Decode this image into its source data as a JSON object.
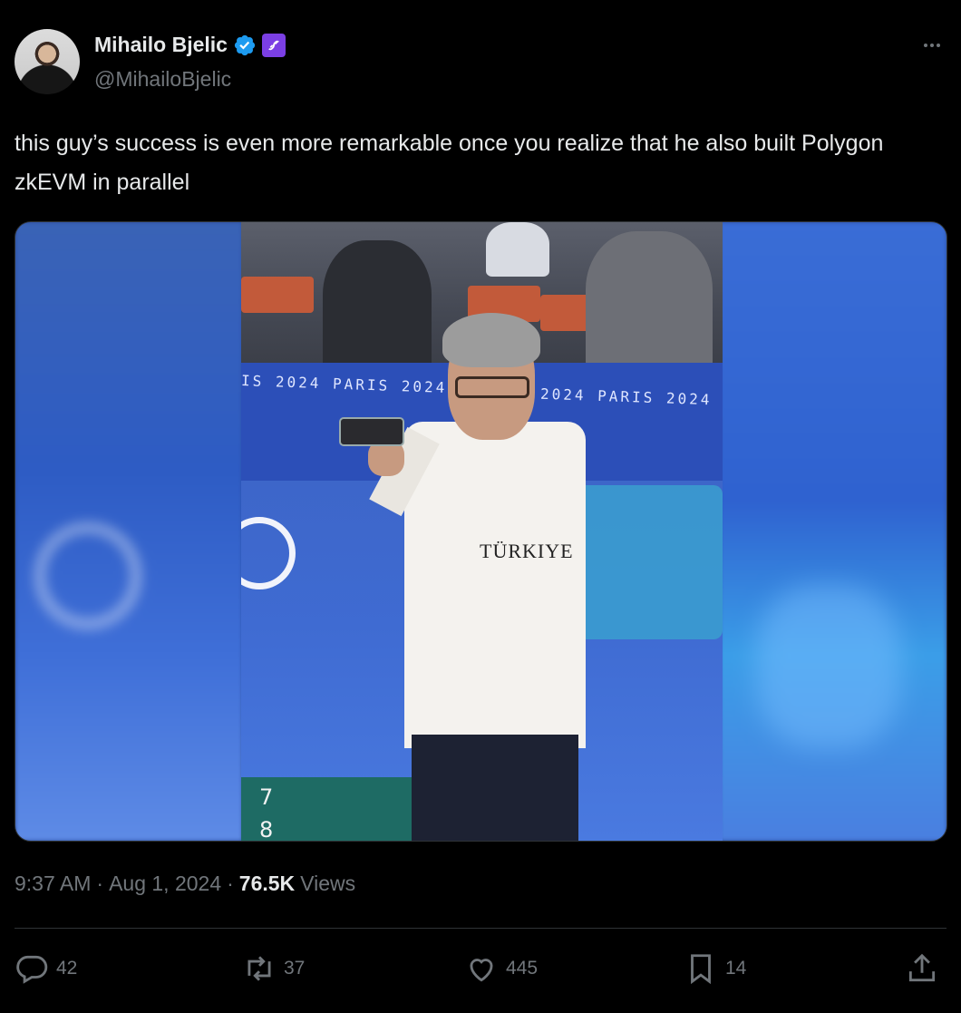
{
  "author": {
    "display_name": "Mihailo Bjelic",
    "handle": "@MihailoBjelic"
  },
  "tweet": {
    "text": "this guy’s success is even more remarkable once you realize that he also built Polygon zkEVM in parallel"
  },
  "media": {
    "banner_left": "IS 2024   PARIS 2024",
    "banner_right": "2024   PARIS 2024",
    "shirt_text": "TÜRKIYE",
    "score_top": "7",
    "score_bottom": "8"
  },
  "meta": {
    "time": "9:37 AM",
    "date": "Aug 1, 2024",
    "views_count": "76.5K",
    "views_label": "Views",
    "separator": "·"
  },
  "actions": {
    "replies": "42",
    "reposts": "37",
    "likes": "445",
    "bookmarks": "14"
  },
  "colors": {
    "background": "#000000",
    "text": "#e7e9ea",
    "muted": "#71767b",
    "verified": "#1d9bf0",
    "affiliate": "#7b3fe4"
  },
  "icons": [
    "verified-badge-icon",
    "affiliate-badge-icon",
    "more-icon",
    "reply-icon",
    "repost-icon",
    "like-icon",
    "bookmark-icon",
    "share-icon"
  ]
}
